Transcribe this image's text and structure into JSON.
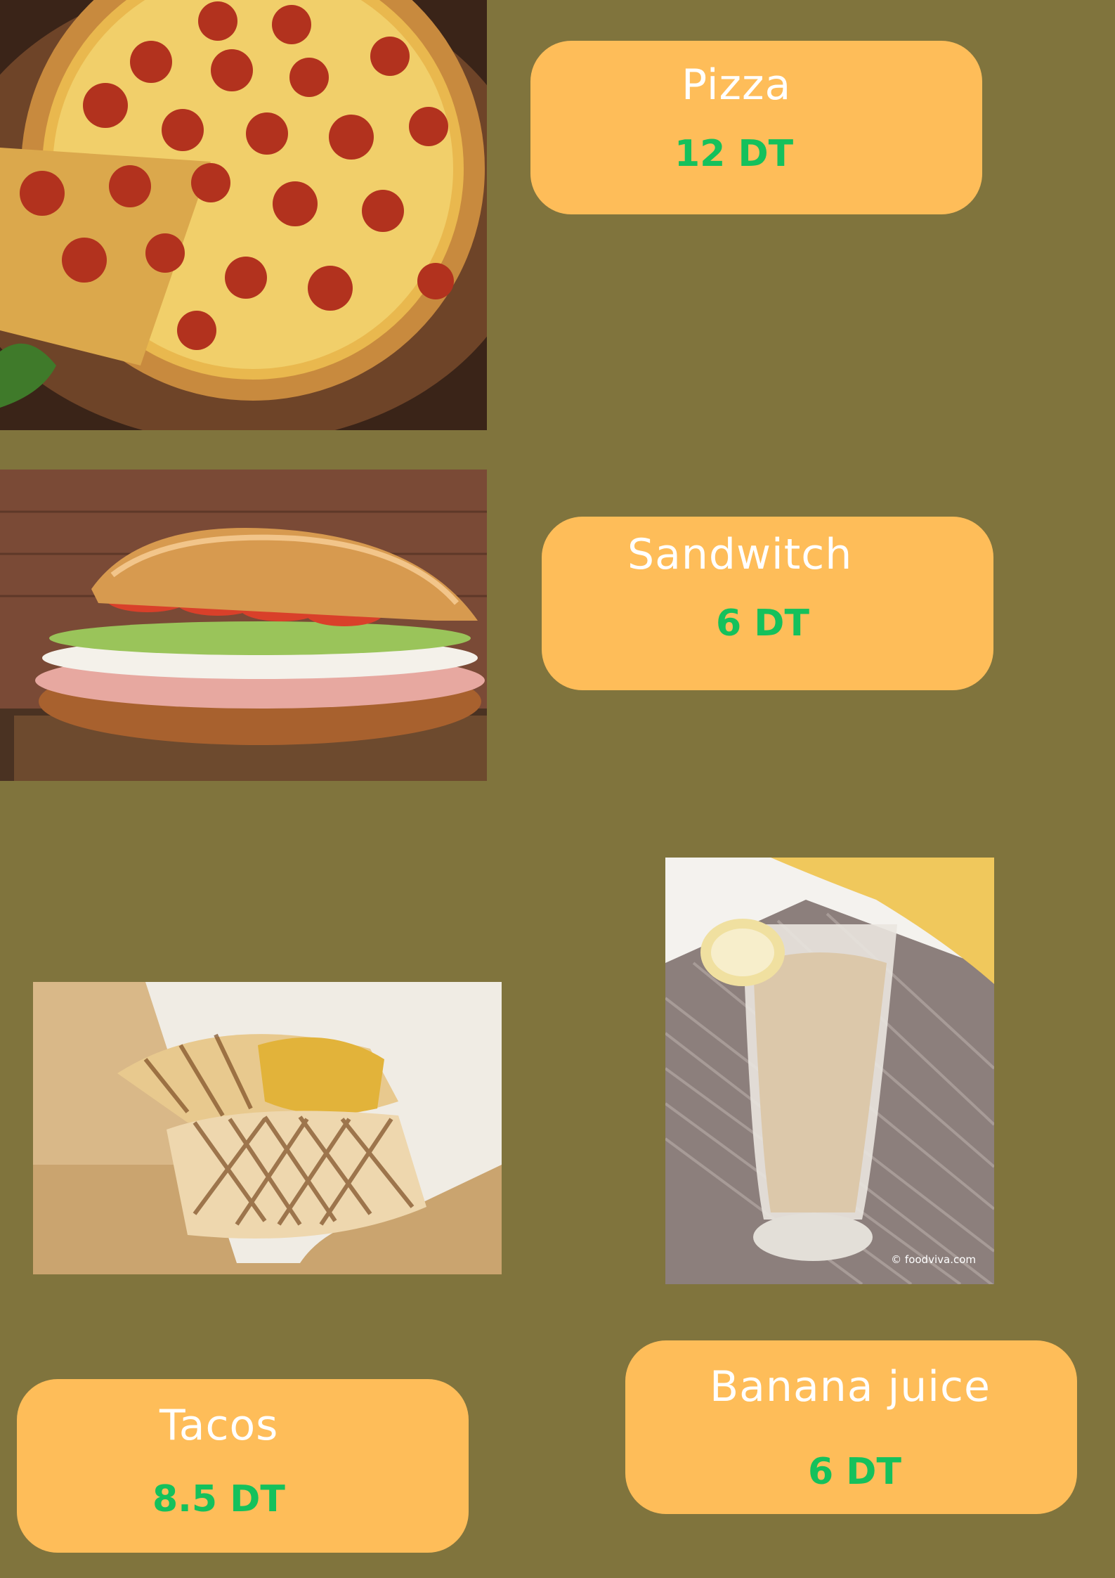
{
  "menu": {
    "items": [
      {
        "name": "Pizza",
        "price": "12 DT",
        "image": "pizza-photo"
      },
      {
        "name": "Sandwitch",
        "price": "6 DT",
        "image": "sandwich-photo"
      },
      {
        "name": "Tacos",
        "price": "8.5 DT",
        "image": "tacos-photo"
      },
      {
        "name": "Banana juice",
        "price": "6 DT",
        "image": "banana-juice-photo",
        "watermark": "© foodviva.com"
      }
    ]
  },
  "colors": {
    "background": "#80743d",
    "card": "#febd59",
    "name_text": "#ffffff",
    "price_text": "#14c15c"
  }
}
